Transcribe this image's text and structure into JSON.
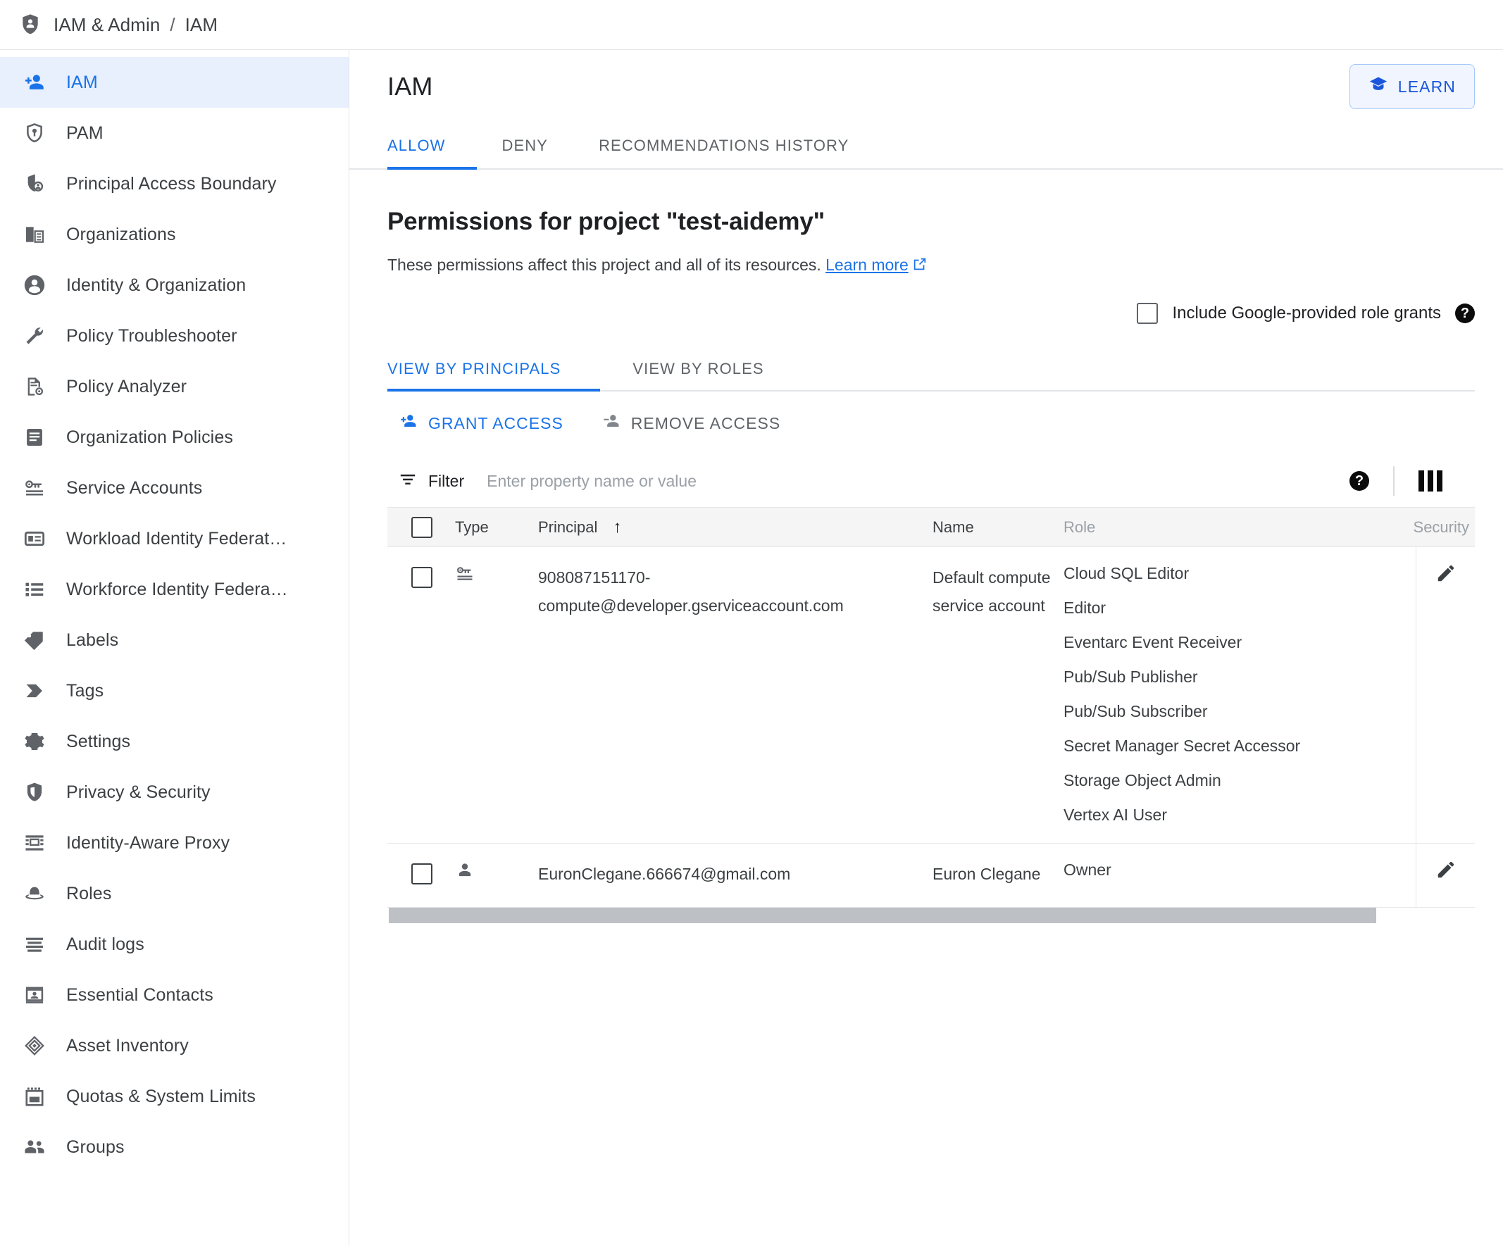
{
  "breadcrumb": {
    "icon": "shield-person-icon",
    "root": "IAM & Admin",
    "separator": "/",
    "current": "IAM"
  },
  "sidebar": {
    "items": [
      {
        "label": "IAM",
        "icon": "person-add-icon",
        "active": true
      },
      {
        "label": "PAM",
        "icon": "shield-key-icon",
        "active": false
      },
      {
        "label": "Principal Access Boundary",
        "icon": "shield-person-boundary-icon",
        "active": false
      },
      {
        "label": "Organizations",
        "icon": "organization-icon",
        "active": false
      },
      {
        "label": "Identity & Organization",
        "icon": "account-circle-icon",
        "active": false
      },
      {
        "label": "Policy Troubleshooter",
        "icon": "wrench-icon",
        "active": false
      },
      {
        "label": "Policy Analyzer",
        "icon": "document-search-icon",
        "active": false
      },
      {
        "label": "Organization Policies",
        "icon": "policy-document-icon",
        "active": false
      },
      {
        "label": "Service Accounts",
        "icon": "key-card-icon",
        "active": false
      },
      {
        "label": "Workload Identity Federat…",
        "icon": "id-card-icon",
        "active": false
      },
      {
        "label": "Workforce Identity Federa…",
        "icon": "list-icon",
        "active": false
      },
      {
        "label": "Labels",
        "icon": "label-icon",
        "active": false
      },
      {
        "label": "Tags",
        "icon": "tag-arrow-icon",
        "active": false
      },
      {
        "label": "Settings",
        "icon": "gear-icon",
        "active": false
      },
      {
        "label": "Privacy & Security",
        "icon": "shield-icon",
        "active": false
      },
      {
        "label": "Identity-Aware Proxy",
        "icon": "proxy-icon",
        "active": false
      },
      {
        "label": "Roles",
        "icon": "hat-icon",
        "active": false
      },
      {
        "label": "Audit logs",
        "icon": "audit-lines-icon",
        "active": false
      },
      {
        "label": "Essential Contacts",
        "icon": "contact-card-icon",
        "active": false
      },
      {
        "label": "Asset Inventory",
        "icon": "diamond-layers-icon",
        "active": false
      },
      {
        "label": "Quotas & System Limits",
        "icon": "quota-icon",
        "active": false
      },
      {
        "label": "Groups",
        "icon": "groups-icon",
        "active": false
      }
    ]
  },
  "header": {
    "title": "IAM",
    "learn_label": "LEARN",
    "learn_icon": "graduation-cap-icon"
  },
  "top_tabs": [
    {
      "label": "ALLOW",
      "selected": true
    },
    {
      "label": "DENY",
      "selected": false
    },
    {
      "label": "RECOMMENDATIONS HISTORY",
      "selected": false
    }
  ],
  "permissions": {
    "title": "Permissions for project \"test-aidemy\"",
    "description": "These permissions affect this project and all of its resources.",
    "learn_more": "Learn more",
    "google_grants_label": "Include Google-provided role grants",
    "google_grants_checked": false,
    "help_icon": "help-icon"
  },
  "view_tabs": [
    {
      "label": "VIEW BY PRINCIPALS",
      "selected": true
    },
    {
      "label": "VIEW BY ROLES",
      "selected": false
    }
  ],
  "actions": {
    "grant_access": "GRANT ACCESS",
    "grant_icon": "person-add-icon",
    "remove_access": "REMOVE ACCESS",
    "remove_icon": "person-remove-icon"
  },
  "filter": {
    "label": "Filter",
    "icon": "filter-icon",
    "placeholder": "Enter property name or value",
    "value": "",
    "help_icon": "help-icon",
    "columns_icon": "column-settings-icon"
  },
  "table": {
    "columns": [
      "Type",
      "Principal",
      "Name",
      "Role",
      "Security"
    ],
    "sort_column": "Principal",
    "sort_direction": "ascending",
    "sort_arrow": "↑",
    "select_all_checked": false,
    "rows": [
      {
        "checked": false,
        "type_icon": "service-account-key-icon",
        "principal": "908087151170-compute@developer.gserviceaccount.com",
        "name": "Default compute service account",
        "roles": [
          "Cloud SQL Editor",
          "Editor",
          "Eventarc Event Receiver",
          "Pub/Sub Publisher",
          "Pub/Sub Subscriber",
          "Secret Manager Secret Accessor",
          "Storage Object Admin",
          "Vertex AI User"
        ],
        "security": "",
        "edit_icon": "pencil-icon"
      },
      {
        "checked": false,
        "type_icon": "user-icon",
        "principal": "EuronClegane.666674@gmail.com",
        "name": "Euron Clegane",
        "roles": [
          "Owner"
        ],
        "security": "",
        "edit_icon": "pencil-icon"
      }
    ]
  },
  "colors": {
    "accent": "#1a73e8",
    "active_bg": "#e8f0fe",
    "text": "#202124",
    "muted": "#5f6368",
    "border": "#e4e6e8",
    "header_bg": "#f5f5f5"
  }
}
